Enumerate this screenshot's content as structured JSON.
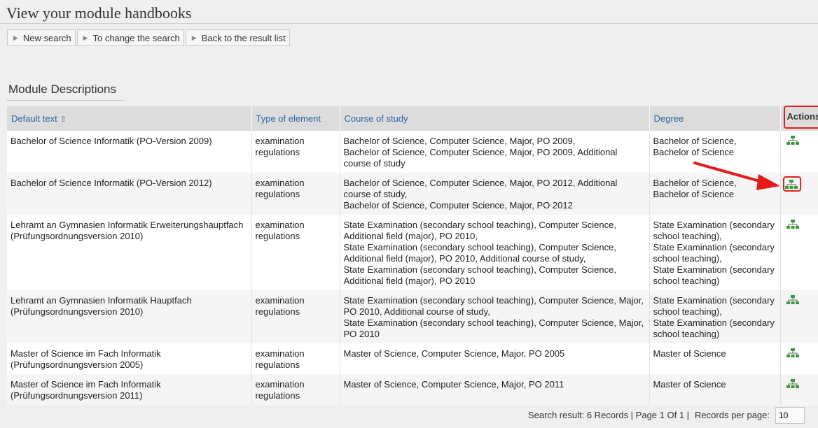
{
  "page": {
    "title": "View your module handbooks"
  },
  "nav": {
    "new_search": "New search",
    "change_search": "To change the search",
    "back_to_results": "Back to the result list"
  },
  "section": {
    "title": "Module Descriptions"
  },
  "table": {
    "headers": {
      "default_text": "Default text",
      "type": "Type of element",
      "course": "Course of study",
      "degree": "Degree",
      "actions": "Actions"
    },
    "rows": [
      {
        "default_text": "Bachelor of Science Informatik (PO-Version 2009)",
        "type": "examination regulations",
        "course": "Bachelor of Science, Computer Science, Major, PO 2009,\nBachelor of Science, Computer Science, Major, PO 2009, Additional course of study",
        "degree": "Bachelor of Science,\nBachelor of Science"
      },
      {
        "default_text": "Bachelor of Science Informatik (PO-Version 2012)",
        "type": "examination regulations",
        "course": "Bachelor of Science, Computer Science, Major, PO 2012, Additional course of study,\nBachelor of Science, Computer Science, Major, PO 2012",
        "degree": "Bachelor of Science,\nBachelor of Science"
      },
      {
        "default_text": "Lehramt an Gymnasien Informatik Erweiterungshauptfach (Prüfungsordnungsversion 2010)",
        "type": "examination regulations",
        "course": "State Examination (secondary school teaching), Computer Science, Additional field (major), PO 2010,\nState Examination (secondary school teaching), Computer Science, Additional field (major), PO 2010, Additional course of study,\nState Examination (secondary school teaching), Computer Science, Additional field (major), PO 2010",
        "degree": "State Examination (secondary school teaching),\nState Examination (secondary school teaching),\nState Examination (secondary school teaching)"
      },
      {
        "default_text": "Lehramt an Gymnasien Informatik Hauptfach (Prüfungsordnungsversion 2010)",
        "type": "examination regulations",
        "course": "State Examination (secondary school teaching), Computer Science, Major, PO 2010, Additional course of study,\nState Examination (secondary school teaching), Computer Science, Major, PO 2010",
        "degree": "State Examination (secondary school teaching),\nState Examination (secondary school teaching)"
      },
      {
        "default_text": "Master of Science im Fach Informatik (Prüfungsordnungsversion 2005)",
        "type": "examination regulations",
        "course": "Master of Science, Computer Science, Major, PO 2005",
        "degree": "Master of Science"
      },
      {
        "default_text": "Master of Science im Fach Informatik (Prüfungsordnungsversion 2011)",
        "type": "examination regulations",
        "course": "Master of Science, Computer Science, Major, PO 2011",
        "degree": "Master of Science"
      }
    ]
  },
  "footer": {
    "search_result": "Search result: 6 Records | Page 1 Of 1 |",
    "records_per_page_label": "Records per page:",
    "records_per_page_value": "10"
  },
  "icons": {
    "nav_button": "triangle-right-icon",
    "sort": "sort-ascending-icon",
    "action": "structure-tree-icon"
  },
  "colors": {
    "link": "#2a64a6",
    "highlight": "#e02020",
    "icon_green": "#3a9a3a"
  }
}
